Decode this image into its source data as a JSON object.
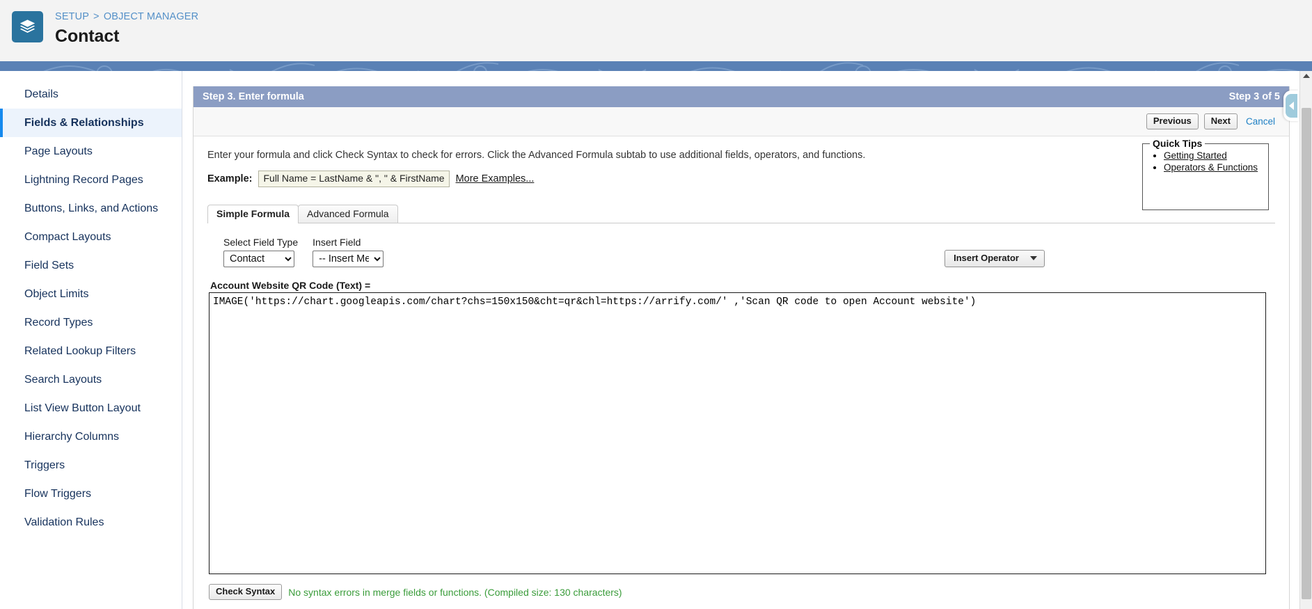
{
  "header": {
    "app_icon": "layers-icon",
    "breadcrumb": {
      "setup": "SETUP",
      "separator": ">",
      "object_manager": "OBJECT MANAGER"
    },
    "title": "Contact"
  },
  "sidebar": {
    "items": [
      {
        "label": "Details",
        "active": false
      },
      {
        "label": "Fields & Relationships",
        "active": true
      },
      {
        "label": "Page Layouts",
        "active": false
      },
      {
        "label": "Lightning Record Pages",
        "active": false
      },
      {
        "label": "Buttons, Links, and Actions",
        "active": false
      },
      {
        "label": "Compact Layouts",
        "active": false
      },
      {
        "label": "Field Sets",
        "active": false
      },
      {
        "label": "Object Limits",
        "active": false
      },
      {
        "label": "Record Types",
        "active": false
      },
      {
        "label": "Related Lookup Filters",
        "active": false
      },
      {
        "label": "Search Layouts",
        "active": false
      },
      {
        "label": "List View Button Layout",
        "active": false
      },
      {
        "label": "Hierarchy Columns",
        "active": false
      },
      {
        "label": "Triggers",
        "active": false
      },
      {
        "label": "Flow Triggers",
        "active": false
      },
      {
        "label": "Validation Rules",
        "active": false
      }
    ]
  },
  "wizard": {
    "step_title": "Step 3. Enter formula",
    "step_counter": "Step 3 of 5",
    "buttons": {
      "previous": "Previous",
      "next": "Next",
      "cancel": "Cancel"
    }
  },
  "main": {
    "instructions": "Enter your formula and click Check Syntax to check for errors. Click the Advanced Formula subtab to use additional fields, operators, and functions.",
    "example": {
      "label": "Example:",
      "value": "Full Name = LastName & \", \" & FirstName",
      "more_link": "More Examples..."
    },
    "quick_tips": {
      "legend": "Quick Tips",
      "links": [
        "Getting Started",
        "Operators & Functions"
      ]
    },
    "tabs": [
      {
        "label": "Simple Formula",
        "active": true
      },
      {
        "label": "Advanced Formula",
        "active": false
      }
    ],
    "field_type": {
      "label": "Select Field Type",
      "selected": "Contact",
      "options": [
        "Contact"
      ]
    },
    "insert_field": {
      "label": "Insert Field",
      "selected": "-- Insert Merge Field --",
      "options": [
        "-- Insert Merge Field --"
      ]
    },
    "insert_operator": {
      "label": "Insert Operator",
      "icon": "caret-down-icon"
    },
    "formula": {
      "label": "Account Website QR Code (Text) =",
      "value": "IMAGE('https://chart.googleapis.com/chart?chs=150x150&cht=qr&chl=https://arrify.com/' ,'Scan QR code to open Account website')"
    },
    "check_syntax": {
      "button": "Check Syntax",
      "message": "No syntax errors in merge fields or functions. (Compiled size: 130 characters)",
      "message_color": "#3a9c3a"
    }
  },
  "chrome": {
    "collapse_panel_icon": "chevron-left-icon",
    "scroll_up_icon": "triangle-up-icon"
  }
}
